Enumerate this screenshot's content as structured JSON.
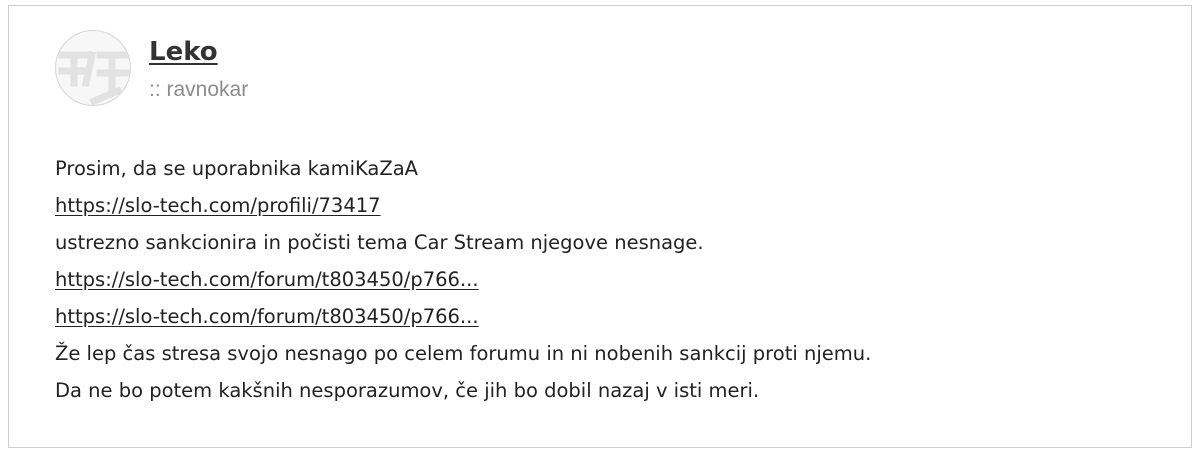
{
  "post": {
    "author": {
      "name": "Leko",
      "title": ":: ravnokar",
      "avatar_icon": "default-avatar-icon"
    },
    "body": {
      "line1": "Prosim, da se uporabnika kamiKaZaA",
      "link1": "https://slo-tech.com/profili/73417",
      "line3": "ustrezno sankcionira in počisti tema Car Stream njegove nesnage.",
      "link2": "https://slo-tech.com/forum/t803450/p766...",
      "link3": "https://slo-tech.com/forum/t803450/p766...",
      "line6": "Že lep čas stresa svojo nesnago po celem forumu in ni nobenih sankcij proti njemu.",
      "line7": "Da ne bo potem kakšnih nesporazumov, če jih bo dobil nazaj v isti meri."
    }
  }
}
